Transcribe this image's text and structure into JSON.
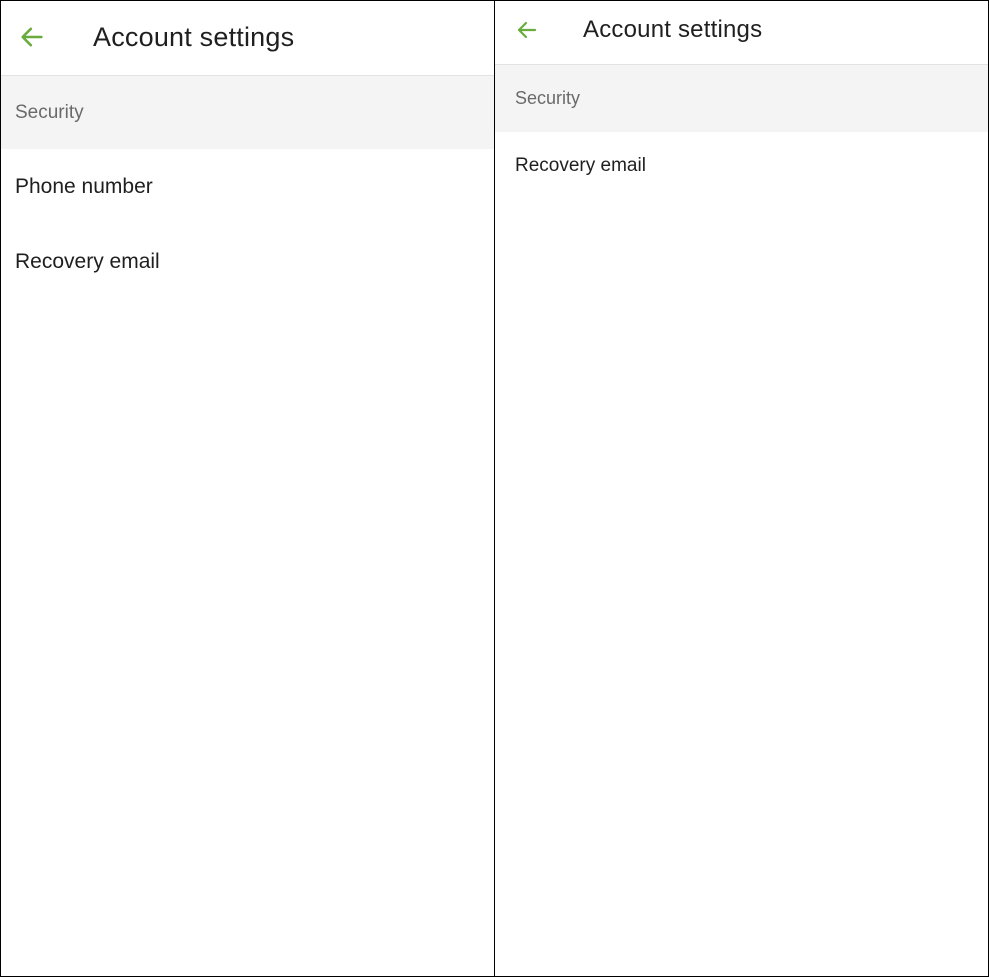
{
  "colors": {
    "accent": "#6aab3f",
    "section_bg": "#f4f4f4",
    "text": "#1f1f1f",
    "section_text": "#6a6a6a"
  },
  "left_panel": {
    "header": {
      "back_icon": "arrow-left-icon",
      "title": "Account settings"
    },
    "section": {
      "label": "Security"
    },
    "items": [
      {
        "label": "Phone number"
      },
      {
        "label": "Recovery email"
      }
    ]
  },
  "right_panel": {
    "header": {
      "back_icon": "arrow-left-icon",
      "title": "Account settings"
    },
    "section": {
      "label": "Security"
    },
    "items": [
      {
        "label": "Recovery email"
      }
    ]
  }
}
